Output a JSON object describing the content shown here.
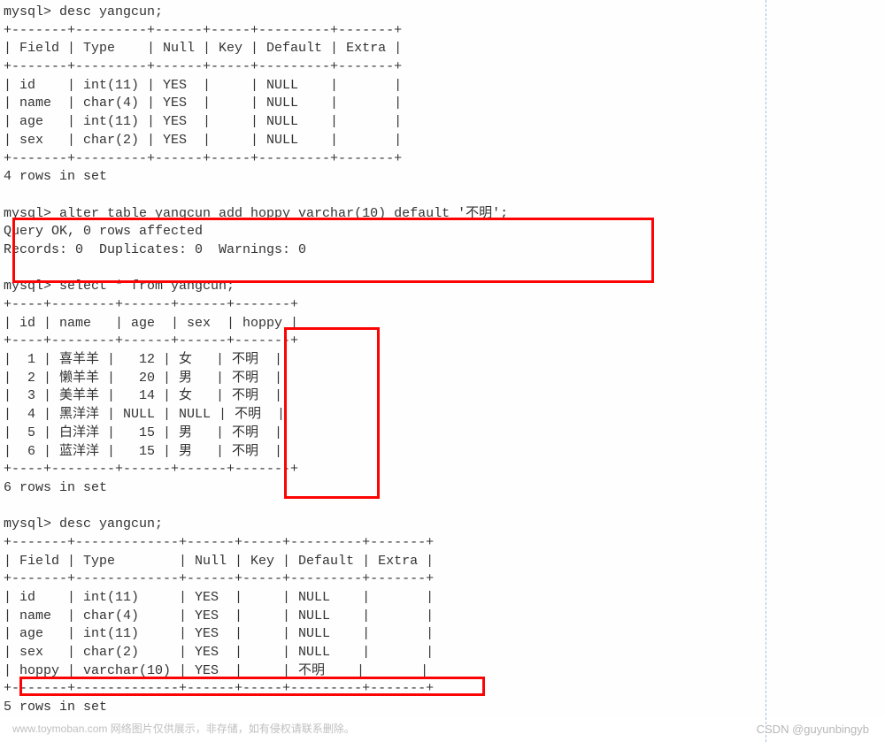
{
  "prompts": {
    "desc1": "mysql> desc yangcun;",
    "alter": "mysql> alter table yangcun add hoppy varchar(10) default '不明';",
    "alter_r1": "Query OK, 0 rows affected",
    "alter_r2": "Records: 0  Duplicates: 0  Warnings: 0",
    "select": "mysql> select * from yangcun;",
    "desc2": "mysql> desc yangcun;",
    "set4": "4 rows in set",
    "set6": "6 rows in set",
    "set5": "5 rows in set"
  },
  "desc1": {
    "border": "+-------+---------+------+-----+---------+-------+",
    "header": "| Field | Type    | Null | Key | Default | Extra |",
    "rows": [
      "| id    | int(11) | YES  |     | NULL    |       |",
      "| name  | char(4) | YES  |     | NULL    |       |",
      "| age   | int(11) | YES  |     | NULL    |       |",
      "| sex   | char(2) | YES  |     | NULL    |       |"
    ]
  },
  "select_tbl": {
    "border": "+----+--------+------+------+-------+",
    "header": "| id | name   | age  | sex  | hoppy |",
    "rows": [
      "|  1 | 喜羊羊 |   12 | 女   | 不明  |",
      "|  2 | 懒羊羊 |   20 | 男   | 不明  |",
      "|  3 | 美羊羊 |   14 | 女   | 不明  |",
      "|  4 | 黑洋洋 | NULL | NULL | 不明  |",
      "|  5 | 白洋洋 |   15 | 男   | 不明  |",
      "|  6 | 蓝洋洋 |   15 | 男   | 不明  |"
    ]
  },
  "desc2": {
    "border": "+-------+-------------+------+-----+---------+-------+",
    "header": "| Field | Type        | Null | Key | Default | Extra |",
    "rows": [
      "| id    | int(11)     | YES  |     | NULL    |       |",
      "| name  | char(4)     | YES  |     | NULL    |       |",
      "| age   | int(11)     | YES  |     | NULL    |       |",
      "| sex   | char(2)     | YES  |     | NULL    |       |",
      "| hoppy | varchar(10) | YES  |     | 不明    |       |"
    ]
  },
  "watermark_left": "www.toymoban.com 网络图片仅供展示，非存储，如有侵权请联系删除。",
  "watermark_right": "CSDN @guyunbingyb"
}
